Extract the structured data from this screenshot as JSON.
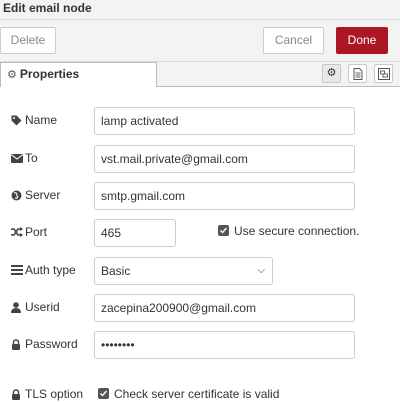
{
  "tray": {
    "title": "Edit email node"
  },
  "toolbar": {
    "delete_label": "Delete",
    "cancel_label": "Cancel",
    "done_label": "Done"
  },
  "tabs": {
    "properties_label": "Properties"
  },
  "form": {
    "name": {
      "label": "Name",
      "value": "lamp activated"
    },
    "to": {
      "label": "To",
      "value": "vst.mail.private@gmail.com"
    },
    "server": {
      "label": "Server",
      "value": "smtp.gmail.com"
    },
    "port": {
      "label": "Port",
      "value": "465"
    },
    "secure": {
      "label": "Use secure connection.",
      "checked": true
    },
    "auth_type": {
      "label": "Auth type",
      "value": "Basic"
    },
    "userid": {
      "label": "Userid",
      "value": "zacepina200900@gmail.com"
    },
    "password": {
      "label": "Password",
      "value": "••••••••"
    },
    "tls": {
      "label": "TLS option",
      "check_label": "Check server certificate is valid",
      "checked": true
    }
  },
  "colors": {
    "done_button": "#ad1625",
    "header_bg": "#f3f3f3"
  },
  "icons": {
    "properties_tab": "cog-icon",
    "name": "tag-icon",
    "to": "envelope-icon",
    "server": "globe-icon",
    "port": "random-icon",
    "auth_type": "list-icon",
    "userid": "user-icon",
    "password": "lock-icon",
    "tls": "lock-icon"
  }
}
